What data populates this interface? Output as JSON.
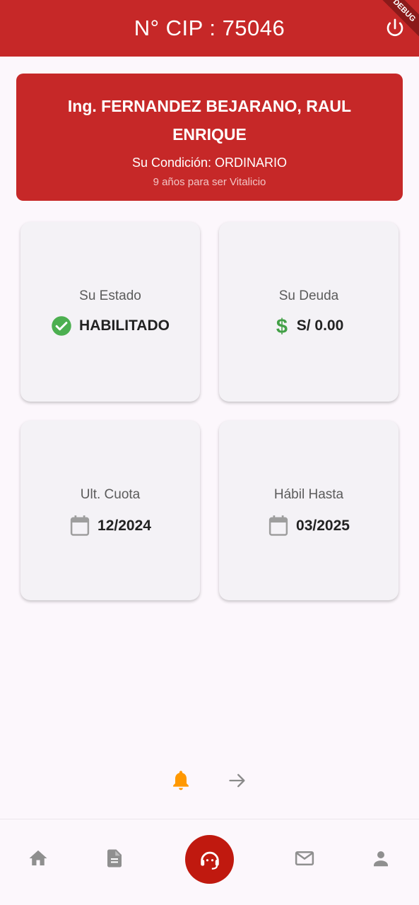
{
  "appbar": {
    "title": "N° CIP : 75046",
    "debug_banner": "DEBUG"
  },
  "profile": {
    "name": "Ing. FERNANDEZ BEJARANO, RAUL ENRIQUE",
    "condition": "Su Condición: ORDINARIO",
    "lifetime_note": "9 años para ser Vitalicio"
  },
  "tiles": {
    "estado": {
      "label": "Su Estado",
      "value": "HABILITADO",
      "icon": "check-circle-icon",
      "icon_color": "#4caf50"
    },
    "deuda": {
      "label": "Su Deuda",
      "value": "S/ 0.00",
      "icon": "dollar-icon",
      "icon_color": "#43a047"
    },
    "cuota": {
      "label": "Ult. Cuota",
      "value": "12/2024",
      "icon": "calendar-icon"
    },
    "habil": {
      "label": "Hábil Hasta",
      "value": "03/2025",
      "icon": "calendar-icon"
    }
  },
  "notifications": {
    "bell_icon": "bell-icon",
    "bell_color": "#ff9800",
    "arrow_icon": "arrow-right-icon"
  },
  "bottom_nav": {
    "items": [
      "home-icon",
      "document-icon",
      "support-agent-icon",
      "mail-icon",
      "person-icon"
    ],
    "center_color": "#c0190f"
  },
  "colors": {
    "primary": "#c62828",
    "background": "#fcf7fc"
  }
}
